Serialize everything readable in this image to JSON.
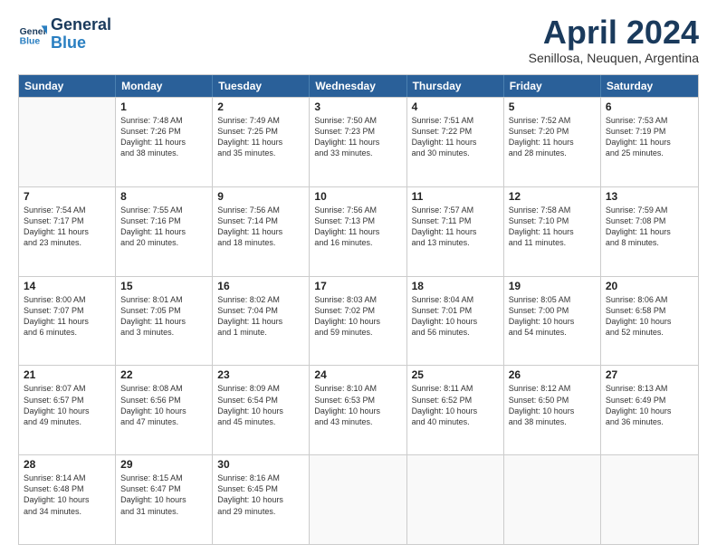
{
  "header": {
    "logo_line1": "General",
    "logo_line2": "Blue",
    "month_title": "April 2024",
    "subtitle": "Senillosa, Neuquen, Argentina"
  },
  "days_of_week": [
    "Sunday",
    "Monday",
    "Tuesday",
    "Wednesday",
    "Thursday",
    "Friday",
    "Saturday"
  ],
  "weeks": [
    [
      {
        "day": "",
        "info": ""
      },
      {
        "day": "1",
        "info": "Sunrise: 7:48 AM\nSunset: 7:26 PM\nDaylight: 11 hours\nand 38 minutes."
      },
      {
        "day": "2",
        "info": "Sunrise: 7:49 AM\nSunset: 7:25 PM\nDaylight: 11 hours\nand 35 minutes."
      },
      {
        "day": "3",
        "info": "Sunrise: 7:50 AM\nSunset: 7:23 PM\nDaylight: 11 hours\nand 33 minutes."
      },
      {
        "day": "4",
        "info": "Sunrise: 7:51 AM\nSunset: 7:22 PM\nDaylight: 11 hours\nand 30 minutes."
      },
      {
        "day": "5",
        "info": "Sunrise: 7:52 AM\nSunset: 7:20 PM\nDaylight: 11 hours\nand 28 minutes."
      },
      {
        "day": "6",
        "info": "Sunrise: 7:53 AM\nSunset: 7:19 PM\nDaylight: 11 hours\nand 25 minutes."
      }
    ],
    [
      {
        "day": "7",
        "info": "Sunrise: 7:54 AM\nSunset: 7:17 PM\nDaylight: 11 hours\nand 23 minutes."
      },
      {
        "day": "8",
        "info": "Sunrise: 7:55 AM\nSunset: 7:16 PM\nDaylight: 11 hours\nand 20 minutes."
      },
      {
        "day": "9",
        "info": "Sunrise: 7:56 AM\nSunset: 7:14 PM\nDaylight: 11 hours\nand 18 minutes."
      },
      {
        "day": "10",
        "info": "Sunrise: 7:56 AM\nSunset: 7:13 PM\nDaylight: 11 hours\nand 16 minutes."
      },
      {
        "day": "11",
        "info": "Sunrise: 7:57 AM\nSunset: 7:11 PM\nDaylight: 11 hours\nand 13 minutes."
      },
      {
        "day": "12",
        "info": "Sunrise: 7:58 AM\nSunset: 7:10 PM\nDaylight: 11 hours\nand 11 minutes."
      },
      {
        "day": "13",
        "info": "Sunrise: 7:59 AM\nSunset: 7:08 PM\nDaylight: 11 hours\nand 8 minutes."
      }
    ],
    [
      {
        "day": "14",
        "info": "Sunrise: 8:00 AM\nSunset: 7:07 PM\nDaylight: 11 hours\nand 6 minutes."
      },
      {
        "day": "15",
        "info": "Sunrise: 8:01 AM\nSunset: 7:05 PM\nDaylight: 11 hours\nand 3 minutes."
      },
      {
        "day": "16",
        "info": "Sunrise: 8:02 AM\nSunset: 7:04 PM\nDaylight: 11 hours\nand 1 minute."
      },
      {
        "day": "17",
        "info": "Sunrise: 8:03 AM\nSunset: 7:02 PM\nDaylight: 10 hours\nand 59 minutes."
      },
      {
        "day": "18",
        "info": "Sunrise: 8:04 AM\nSunset: 7:01 PM\nDaylight: 10 hours\nand 56 minutes."
      },
      {
        "day": "19",
        "info": "Sunrise: 8:05 AM\nSunset: 7:00 PM\nDaylight: 10 hours\nand 54 minutes."
      },
      {
        "day": "20",
        "info": "Sunrise: 8:06 AM\nSunset: 6:58 PM\nDaylight: 10 hours\nand 52 minutes."
      }
    ],
    [
      {
        "day": "21",
        "info": "Sunrise: 8:07 AM\nSunset: 6:57 PM\nDaylight: 10 hours\nand 49 minutes."
      },
      {
        "day": "22",
        "info": "Sunrise: 8:08 AM\nSunset: 6:56 PM\nDaylight: 10 hours\nand 47 minutes."
      },
      {
        "day": "23",
        "info": "Sunrise: 8:09 AM\nSunset: 6:54 PM\nDaylight: 10 hours\nand 45 minutes."
      },
      {
        "day": "24",
        "info": "Sunrise: 8:10 AM\nSunset: 6:53 PM\nDaylight: 10 hours\nand 43 minutes."
      },
      {
        "day": "25",
        "info": "Sunrise: 8:11 AM\nSunset: 6:52 PM\nDaylight: 10 hours\nand 40 minutes."
      },
      {
        "day": "26",
        "info": "Sunrise: 8:12 AM\nSunset: 6:50 PM\nDaylight: 10 hours\nand 38 minutes."
      },
      {
        "day": "27",
        "info": "Sunrise: 8:13 AM\nSunset: 6:49 PM\nDaylight: 10 hours\nand 36 minutes."
      }
    ],
    [
      {
        "day": "28",
        "info": "Sunrise: 8:14 AM\nSunset: 6:48 PM\nDaylight: 10 hours\nand 34 minutes."
      },
      {
        "day": "29",
        "info": "Sunrise: 8:15 AM\nSunset: 6:47 PM\nDaylight: 10 hours\nand 31 minutes."
      },
      {
        "day": "30",
        "info": "Sunrise: 8:16 AM\nSunset: 6:45 PM\nDaylight: 10 hours\nand 29 minutes."
      },
      {
        "day": "",
        "info": ""
      },
      {
        "day": "",
        "info": ""
      },
      {
        "day": "",
        "info": ""
      },
      {
        "day": "",
        "info": ""
      }
    ]
  ]
}
